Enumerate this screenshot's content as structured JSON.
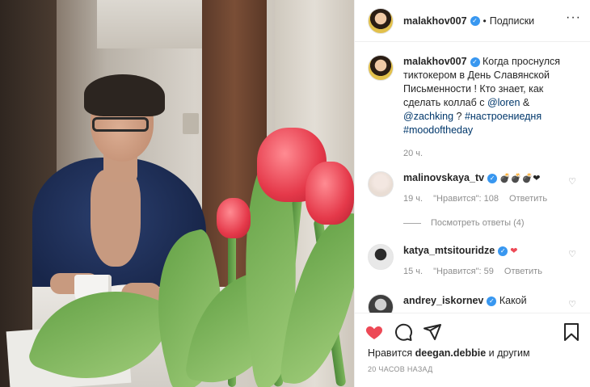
{
  "post": {
    "username": "malakhov007",
    "follow_label": "Подписки",
    "dot": "•",
    "more_label": "···"
  },
  "caption": {
    "username": "malakhov007",
    "text_1": " Когда проснулся тиктокером в День Славянской Письменности ! Кто знает, как сделать коллаб с ",
    "mention_1": "@loren",
    "text_2": " & ",
    "mention_2": "@zachking",
    "text_3": " ? ",
    "hashtag_1": "#настроениедня",
    "text_4": " ",
    "hashtag_2": "#moodoftheday",
    "time": "20 ч."
  },
  "comments": [
    {
      "username": "malinovskaya_tv",
      "text": " 💣💣💣❤",
      "time": "19 ч.",
      "likes": "\"Нравится\": 108",
      "reply": "Ответить"
    },
    {
      "username": "katya_mtsitouridze",
      "text": " ❤",
      "time": "15 ч.",
      "likes": "\"Нравится\": 59",
      "reply": "Ответить"
    },
    {
      "username": "andrey_iskornev",
      "text": " Какой"
    }
  ],
  "view_replies": "Посмотреть ответы (4)",
  "footer": {
    "likes_prefix": "Нравится ",
    "likes_user": "deegan.debbie",
    "likes_suffix": " и другим",
    "timestamp": "20 ЧАСОВ НАЗАД"
  },
  "icons": {
    "like": "heart-icon",
    "comment": "comment-icon",
    "share": "share-icon",
    "save": "bookmark-icon"
  },
  "colors": {
    "like": "#ed4956",
    "link": "#00376b",
    "verified": "#3897f0",
    "muted": "#8e8e8e"
  }
}
